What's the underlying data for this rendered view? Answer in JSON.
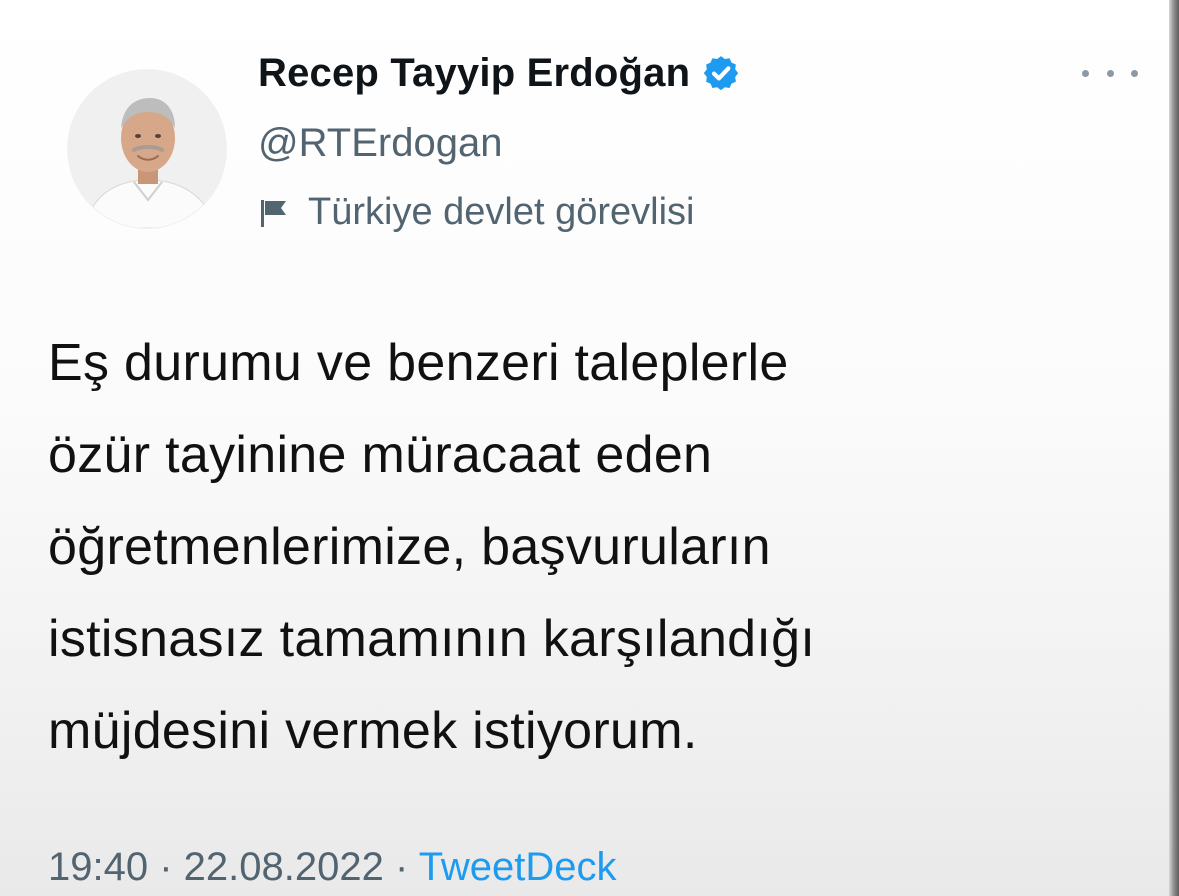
{
  "tweet": {
    "author": {
      "display_name": "Recep Tayyip Erdoğan",
      "handle": "@RTErdogan",
      "verified": true,
      "label": "Türkiye devlet görevlisi",
      "label_icon": "flag-icon"
    },
    "more_icon": "more-icon",
    "text_lines": [
      "Eş durumu ve benzeri taleplerle",
      "özür tayinine müracaat eden",
      "öğretmenlerimize, başvuruların",
      "istisnasız tamamının karşılandığı",
      "müjdesini vermek istiyorum."
    ],
    "meta": {
      "time": "19:40",
      "separator": " · ",
      "date": "22.08.2022",
      "source": "TweetDeck"
    }
  },
  "colors": {
    "text": "#0f1419",
    "secondary": "#536471",
    "link": "#1d9bf0",
    "verified": "#1d9bf0"
  }
}
